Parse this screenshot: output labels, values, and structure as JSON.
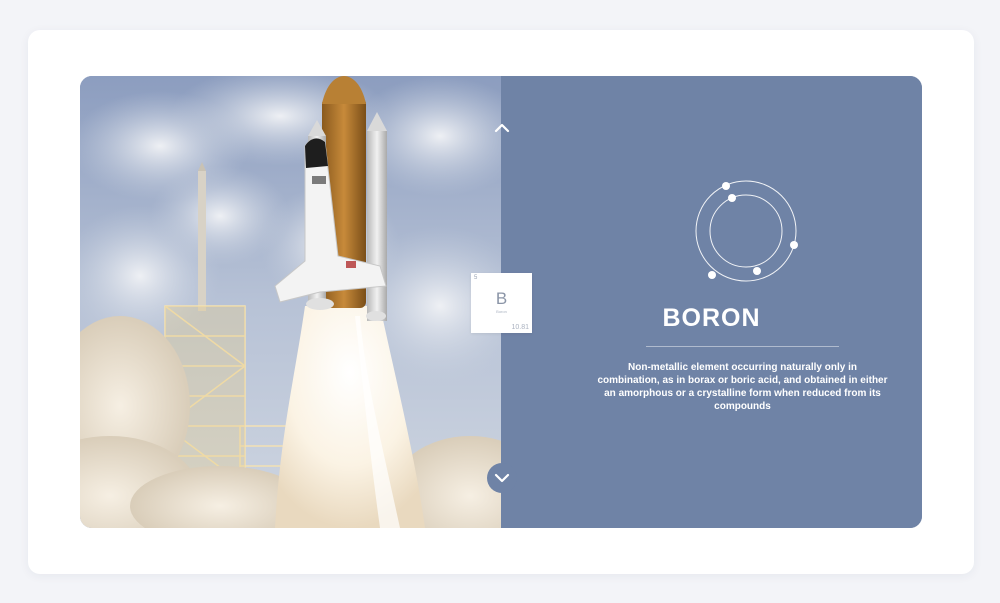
{
  "element": {
    "number": "5",
    "symbol": "B",
    "name": "Boron",
    "mass": "10.81",
    "title": "BORON",
    "description": "Non-metallic element occurring naturally only in combination, as in borax or boric acid, and obtained in either an amorphous or a crystalline form when reduced from its compounds"
  },
  "nav": {
    "up_icon": "chevron-up-icon",
    "down_icon": "chevron-down-icon"
  },
  "colors": {
    "panel": "#6f83a6",
    "sky": "#b9c4d8",
    "text": "#ffffff"
  }
}
